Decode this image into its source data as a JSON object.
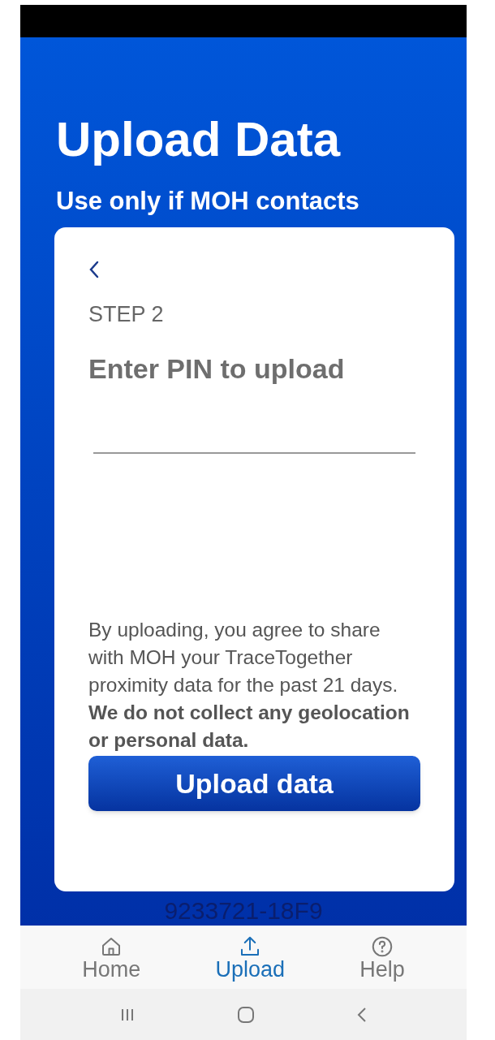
{
  "header": {
    "title": "Upload Data",
    "subtitle": "Use only if MOH contacts"
  },
  "card": {
    "step": "STEP 2",
    "heading": "Enter PIN to upload",
    "consent": "By uploading, you agree to share with MOH your TraceTogether proximity data for the past 21 days. **We do not collect any geolocation or personal data.**",
    "button": "Upload data"
  },
  "device_id": "9233721-18F9",
  "nav": [
    {
      "label": "Home",
      "kind": "home",
      "selected": false
    },
    {
      "label": "Upload",
      "kind": "upload",
      "selected": true
    },
    {
      "label": "Help",
      "kind": "help",
      "selected": false
    }
  ]
}
